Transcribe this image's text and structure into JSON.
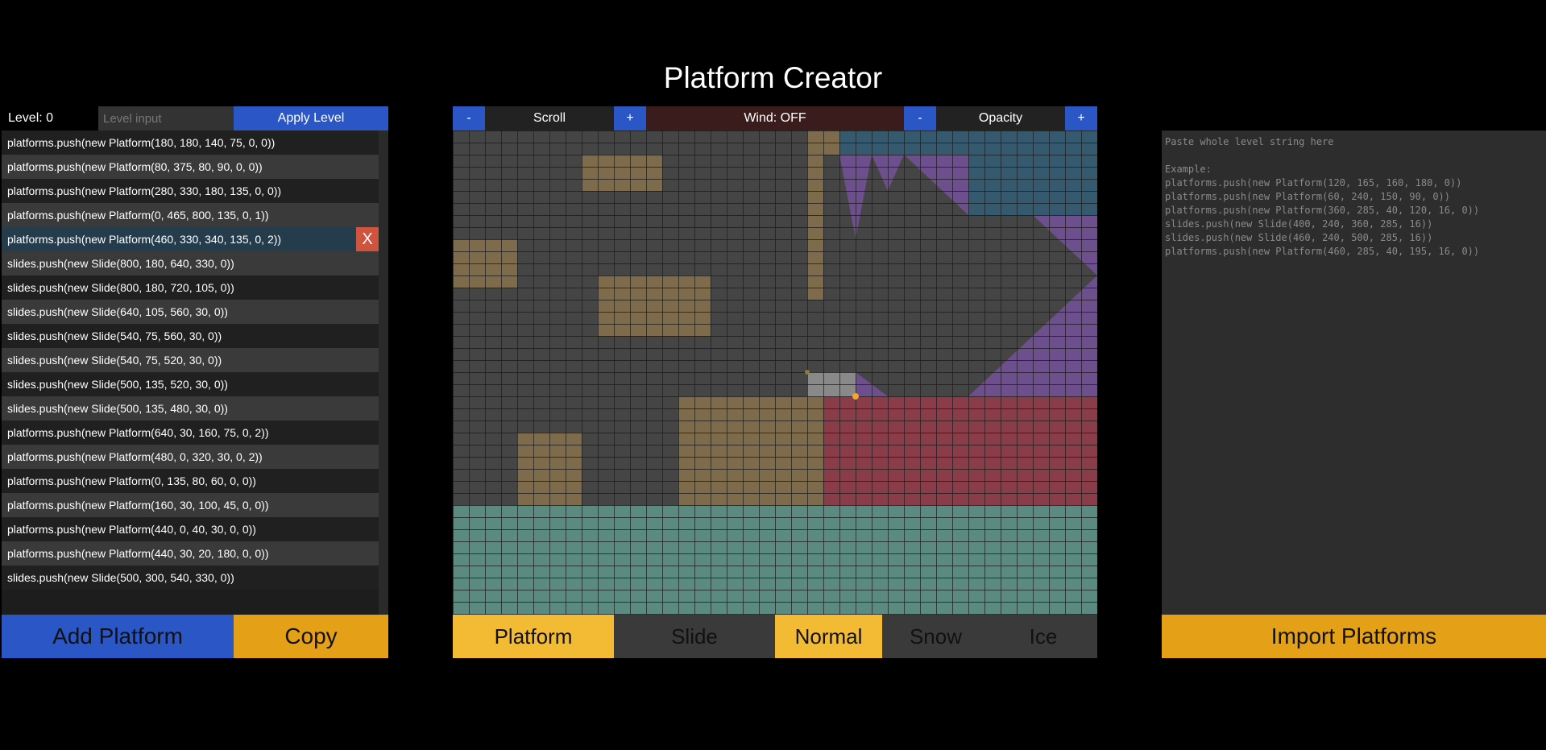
{
  "title": "Platform Creator",
  "left": {
    "level_label": "Level: 0",
    "level_placeholder": "Level input",
    "apply_label": "Apply Level",
    "items": [
      "platforms.push(new Platform(180, 180, 140, 75, 0, 0))",
      "platforms.push(new Platform(80, 375, 80, 90, 0, 0))",
      "platforms.push(new Platform(280, 330, 180, 135, 0, 0))",
      "platforms.push(new Platform(0, 465, 800, 135, 0, 1))",
      "platforms.push(new Platform(460, 330, 340, 135, 0, 2))",
      "slides.push(new Slide(800, 180, 640, 330, 0))",
      "slides.push(new Slide(800, 180, 720, 105, 0))",
      "slides.push(new Slide(640, 105, 560, 30, 0))",
      "slides.push(new Slide(540, 75, 560, 30, 0))",
      "slides.push(new Slide(540, 75, 520, 30, 0))",
      "slides.push(new Slide(500, 135, 520, 30, 0))",
      "slides.push(new Slide(500, 135, 480, 30, 0))",
      "platforms.push(new Platform(640, 30, 160, 75, 0, 2))",
      "platforms.push(new Platform(480, 0, 320, 30, 0, 2))",
      "platforms.push(new Platform(0, 135, 80, 60, 0, 0))",
      "platforms.push(new Platform(160, 30, 100, 45, 0, 0))",
      "platforms.push(new Platform(440, 0, 40, 30, 0, 0))",
      "platforms.push(new Platform(440, 30, 20, 180, 0, 0))",
      "slides.push(new Slide(500, 300, 540, 330, 0))"
    ],
    "selected_index": 4,
    "delete_label": "X",
    "add_label": "Add Platform",
    "copy_label": "Copy"
  },
  "controls": {
    "minus": "-",
    "plus": "+",
    "scroll_label": "Scroll",
    "wind_label": "Wind: OFF",
    "opacity_label": "Opacity"
  },
  "modes": {
    "platform": "Platform",
    "slide": "Slide",
    "normal": "Normal",
    "snow": "Snow",
    "ice": "Ice"
  },
  "right": {
    "import_placeholder": "Paste whole level string here\n\nExample:\nplatforms.push(new Platform(120, 165, 160, 180, 0))\nplatforms.push(new Platform(60, 240, 150, 90, 0))\nplatforms.push(new Platform(360, 285, 40, 120, 16, 0))\nslides.push(new Slide(400, 240, 360, 285, 16))\nslides.push(new Slide(460, 240, 500, 285, 16))\nplatforms.push(new Platform(460, 285, 40, 195, 16, 0))",
    "import_label": "Import Platforms"
  },
  "colors": {
    "accent_blue": "#2a56c6",
    "accent_yellow": "#f3bb33",
    "copy_orange": "#e4a117",
    "delete_red": "#d0533d",
    "normal_platform": "#7d6b4b",
    "snow_platform": "#5a8a80",
    "ice_platform": "#8a3d48",
    "slide": "#6e4f8e",
    "sky": "#355a70"
  }
}
